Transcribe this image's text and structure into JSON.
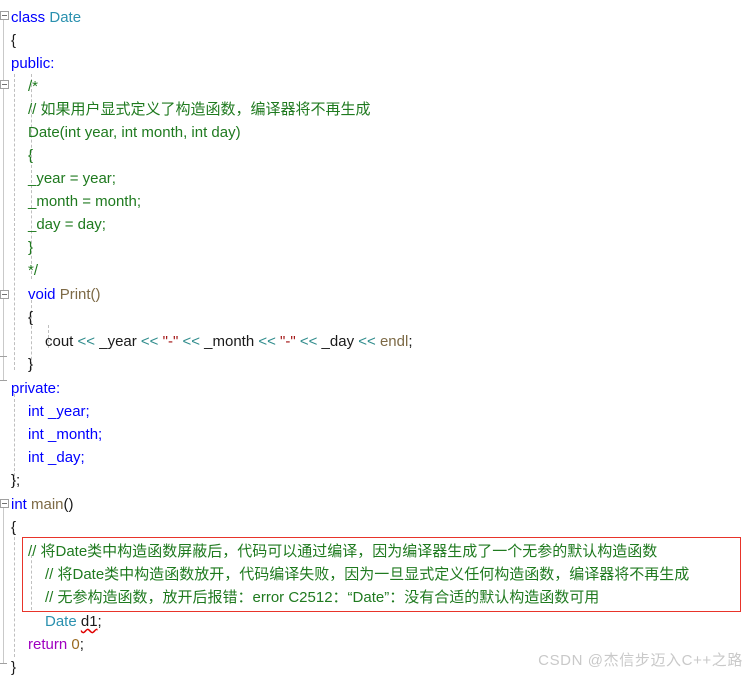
{
  "editor": {
    "language": "cpp",
    "background_color": "#ffffff",
    "font_size_px": 15,
    "line_height_px": 23,
    "colors": {
      "keyword": "#0000ff",
      "type": "#2b91af",
      "function": "#7d6a46",
      "comment": "#1f7a1f",
      "string": "#a31515",
      "operator": "#2e8b8b",
      "control_keyword": "#a000c0",
      "number": "#9a6a20",
      "plain_text": "#1a1a1a",
      "annotation_rect": "#e8342a",
      "error_squiggle": "#e00000",
      "indent_guide": "#bfbfbf",
      "fold_marker": "#a0a0a0",
      "watermark": "#c9c9c9"
    },
    "lines": [
      {
        "n": 1,
        "indent": 0,
        "text": "class Date"
      },
      {
        "n": 2,
        "indent": 0,
        "text": "{"
      },
      {
        "n": 3,
        "indent": 0,
        "text": "public:"
      },
      {
        "n": 4,
        "indent": 1,
        "text": "/*"
      },
      {
        "n": 5,
        "indent": 1,
        "text": "// 如果用户显式定义了构造函数，编译器将不再生成"
      },
      {
        "n": 6,
        "indent": 1,
        "text": "Date(int year, int month, int day)"
      },
      {
        "n": 7,
        "indent": 1,
        "text": "{"
      },
      {
        "n": 8,
        "indent": 1,
        "text": "_year = year;"
      },
      {
        "n": 9,
        "indent": 1,
        "text": "_month = month;"
      },
      {
        "n": 10,
        "indent": 1,
        "text": "_day = day;"
      },
      {
        "n": 11,
        "indent": 1,
        "text": "}"
      },
      {
        "n": 12,
        "indent": 1,
        "text": "*/"
      },
      {
        "n": 13,
        "indent": 1,
        "text": "void Print()"
      },
      {
        "n": 14,
        "indent": 1,
        "text": "{"
      },
      {
        "n": 15,
        "indent": 2,
        "text": "cout << _year << \"-\" << _month << \"-\" << _day << endl;"
      },
      {
        "n": 16,
        "indent": 1,
        "text": "}"
      },
      {
        "n": 17,
        "indent": 0,
        "text": "private:"
      },
      {
        "n": 18,
        "indent": 1,
        "text": "int _year;"
      },
      {
        "n": 19,
        "indent": 1,
        "text": "int _month;"
      },
      {
        "n": 20,
        "indent": 1,
        "text": "int _day;"
      },
      {
        "n": 21,
        "indent": 0,
        "text": "};"
      },
      {
        "n": 22,
        "indent": 0,
        "text": "int main()"
      },
      {
        "n": 23,
        "indent": 0,
        "text": "{"
      },
      {
        "n": 24,
        "indent": 1,
        "text": "// 将Date类中构造函数屏蔽后，代码可以通过编译，因为编译器生成了一个无参的默认构造函数"
      },
      {
        "n": 25,
        "indent": 2,
        "text": "// 将Date类中构造函数放开，代码编译失败，因为一旦显式定义任何构造函数，编译器将不再生成"
      },
      {
        "n": 26,
        "indent": 2,
        "text": "// 无参构造函数，放开后报错：error C2512：“Date”：没有合适的默认构造函数可用"
      },
      {
        "n": 27,
        "indent": 2,
        "text": "Date d1;"
      },
      {
        "n": 28,
        "indent": 1,
        "text": "return 0;"
      },
      {
        "n": 29,
        "indent": 0,
        "text": "}"
      }
    ],
    "tokens": {
      "kw_class": "class",
      "kw_public": "public:",
      "kw_private": "private:",
      "kw_void": "void",
      "kw_int": "int",
      "kw_return": "return",
      "type_Date": "Date",
      "fn_Print": "Print",
      "fn_main": "main",
      "id_cout": "cout",
      "id_endl": "endl",
      "id_year": "_year",
      "id_month": "_month",
      "id_day": "_day",
      "id_d1": "d1",
      "num_zero": "0",
      "op_shift": "<<",
      "str_dash": "\"-\"",
      "comment_open": "/*",
      "comment_close": "*/"
    },
    "line_texts": {
      "l1_kw": "class",
      "l1_type": "Date",
      "l2": "{",
      "l3": "public:",
      "l4": "/*",
      "l5": "// 如果用户显式定义了构造函数，编译器将不再生成",
      "l6": "Date(int year, int month, int day)",
      "l7": "{",
      "l8": "_year = year;",
      "l9": "_month = month;",
      "l10": "_day = day;",
      "l11": "}",
      "l12": "*/",
      "l13_kw": "void",
      "l13_fn": "Print()",
      "l14": "{",
      "l15_cout": "cout ",
      "l15_op1": "<<",
      "l15_year": " _year ",
      "l15_op2": "<<",
      "l15_str1": " \"-\" ",
      "l15_op3": "<<",
      "l15_month": " _month ",
      "l15_op4": "<<",
      "l15_str2": " \"-\" ",
      "l15_op5": "<<",
      "l15_day": " _day ",
      "l15_op6": "<<",
      "l15_endl": " endl",
      "l15_semi": ";",
      "l16": "}",
      "l17": "private:",
      "l18_kw": "int",
      "l18_id": " _year;",
      "l19_kw": "int",
      "l19_id": " _month;",
      "l20_kw": "int",
      "l20_id": " _day;",
      "l21": "};",
      "l22_kw": "int",
      "l22_fn": " main",
      "l22_paren": "()",
      "l23": "{",
      "l24": "// 将Date类中构造函数屏蔽后，代码可以通过编译，因为编译器生成了一个无参的默认构造函数",
      "l25": "// 将Date类中构造函数放开，代码编译失败，因为一旦显式定义任何构造函数，编译器将不再生成",
      "l26": "// 无参构造函数，放开后报错：error C2512：“Date”：没有合适的默认构造函数可用",
      "l27_type": "Date",
      "l27_space": " ",
      "l27_id": "d1",
      "l27_semi": ";",
      "l28_kw": "return",
      "l28_num": " 0",
      "l28_semi": ";",
      "l29": "}"
    }
  },
  "annotation": {
    "shape": "rectangle",
    "color": "#e8342a",
    "covers_lines": "24-26",
    "purpose": "highlights the three explanatory comment lines"
  },
  "watermark": {
    "text": "CSDN @杰信步迈入C++之路"
  }
}
